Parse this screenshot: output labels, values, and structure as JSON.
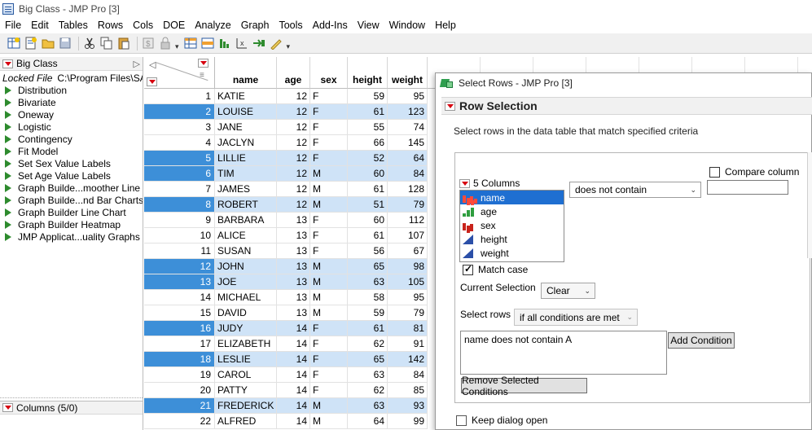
{
  "window": {
    "title": "Big Class - JMP Pro [3]"
  },
  "menu": [
    "File",
    "Edit",
    "Tables",
    "Rows",
    "Cols",
    "DOE",
    "Analyze",
    "Graph",
    "Tools",
    "Add-Ins",
    "View",
    "Window",
    "Help"
  ],
  "toolbar_icons": [
    "new-data-table-icon",
    "new-script-icon",
    "open-icon",
    "save-icon",
    "cut-icon",
    "copy-icon",
    "paste-icon",
    "journal-icon",
    "lock-icon",
    "data-table-icon",
    "subset-icon",
    "distribution-icon",
    "fit-y-by-x-icon",
    "fit-model-icon",
    "graph-builder-icon"
  ],
  "left_panel": {
    "table_name": "Big Class",
    "locked_label": "Locked File",
    "locked_path": "C:\\Program Files\\SA",
    "scripts": [
      "Distribution",
      "Bivariate",
      "Oneway",
      "Logistic",
      "Contingency",
      "Fit Model",
      "Set Sex Value Labels",
      "Set Age Value Labels",
      "Graph Builde...moother Line",
      "Graph Builde...nd Bar Charts",
      "Graph Builder Line Chart",
      "Graph Builder Heatmap",
      "JMP Applicat...uality Graphs"
    ],
    "columns_label": "Columns (5/0)"
  },
  "grid": {
    "headers": [
      "name",
      "age",
      "sex",
      "height",
      "weight"
    ],
    "rows": [
      {
        "n": "1",
        "name": "KATIE",
        "age": "12",
        "sex": "F",
        "height": "59",
        "weight": "95",
        "sel": false
      },
      {
        "n": "2",
        "name": "LOUISE",
        "age": "12",
        "sex": "F",
        "height": "61",
        "weight": "123",
        "sel": true
      },
      {
        "n": "3",
        "name": "JANE",
        "age": "12",
        "sex": "F",
        "height": "55",
        "weight": "74",
        "sel": false
      },
      {
        "n": "4",
        "name": "JACLYN",
        "age": "12",
        "sex": "F",
        "height": "66",
        "weight": "145",
        "sel": false
      },
      {
        "n": "5",
        "name": "LILLIE",
        "age": "12",
        "sex": "F",
        "height": "52",
        "weight": "64",
        "sel": true
      },
      {
        "n": "6",
        "name": "TIM",
        "age": "12",
        "sex": "M",
        "height": "60",
        "weight": "84",
        "sel": true
      },
      {
        "n": "7",
        "name": "JAMES",
        "age": "12",
        "sex": "M",
        "height": "61",
        "weight": "128",
        "sel": false
      },
      {
        "n": "8",
        "name": "ROBERT",
        "age": "12",
        "sex": "M",
        "height": "51",
        "weight": "79",
        "sel": true
      },
      {
        "n": "9",
        "name": "BARBARA",
        "age": "13",
        "sex": "F",
        "height": "60",
        "weight": "112",
        "sel": false
      },
      {
        "n": "10",
        "name": "ALICE",
        "age": "13",
        "sex": "F",
        "height": "61",
        "weight": "107",
        "sel": false
      },
      {
        "n": "11",
        "name": "SUSAN",
        "age": "13",
        "sex": "F",
        "height": "56",
        "weight": "67",
        "sel": false
      },
      {
        "n": "12",
        "name": "JOHN",
        "age": "13",
        "sex": "M",
        "height": "65",
        "weight": "98",
        "sel": true
      },
      {
        "n": "13",
        "name": "JOE",
        "age": "13",
        "sex": "M",
        "height": "63",
        "weight": "105",
        "sel": true
      },
      {
        "n": "14",
        "name": "MICHAEL",
        "age": "13",
        "sex": "M",
        "height": "58",
        "weight": "95",
        "sel": false
      },
      {
        "n": "15",
        "name": "DAVID",
        "age": "13",
        "sex": "M",
        "height": "59",
        "weight": "79",
        "sel": false
      },
      {
        "n": "16",
        "name": "JUDY",
        "age": "14",
        "sex": "F",
        "height": "61",
        "weight": "81",
        "sel": true
      },
      {
        "n": "17",
        "name": "ELIZABETH",
        "age": "14",
        "sex": "F",
        "height": "62",
        "weight": "91",
        "sel": false
      },
      {
        "n": "18",
        "name": "LESLIE",
        "age": "14",
        "sex": "F",
        "height": "65",
        "weight": "142",
        "sel": true
      },
      {
        "n": "19",
        "name": "CAROL",
        "age": "14",
        "sex": "F",
        "height": "63",
        "weight": "84",
        "sel": false
      },
      {
        "n": "20",
        "name": "PATTY",
        "age": "14",
        "sex": "F",
        "height": "62",
        "weight": "85",
        "sel": false
      },
      {
        "n": "21",
        "name": "FREDERICK",
        "age": "14",
        "sex": "M",
        "height": "63",
        "weight": "93",
        "sel": true
      },
      {
        "n": "22",
        "name": "ALFRED",
        "age": "14",
        "sex": "M",
        "height": "64",
        "weight": "99",
        "sel": false
      }
    ]
  },
  "dialog": {
    "title": "Select Rows - JMP Pro [3]",
    "section": "Row Selection",
    "description": "Select rows in the data table that match specified criteria",
    "columns_label": "5 Columns",
    "columns": [
      {
        "name": "name",
        "type": "nominal",
        "selected": true
      },
      {
        "name": "age",
        "type": "ordinal",
        "selected": false
      },
      {
        "name": "sex",
        "type": "nominal",
        "selected": false
      },
      {
        "name": "height",
        "type": "continuous",
        "selected": false
      },
      {
        "name": "weight",
        "type": "continuous",
        "selected": false
      }
    ],
    "operator": "does not contain",
    "compare_column_label": "Compare column",
    "compare_value": "",
    "match_case_label": "Match case",
    "match_case_checked": true,
    "current_selection_label": "Current Selection",
    "current_selection_value": "Clear",
    "select_rows_label": "Select rows",
    "condition_mode": "if all conditions are met",
    "conditions_text": "name does not contain A",
    "add_condition": "Add Condition",
    "remove_conditions": "Remove Selected Conditions",
    "keep_open_label": "Keep dialog open",
    "keep_open_checked": false
  },
  "colors": {
    "selected_row_fill": "#cfe3f7",
    "selected_rownum_fill": "#3d8fd8",
    "list_selection": "#1f6fd1",
    "red_triangle": "#d7000f",
    "script_play": "#2e8b2e"
  }
}
